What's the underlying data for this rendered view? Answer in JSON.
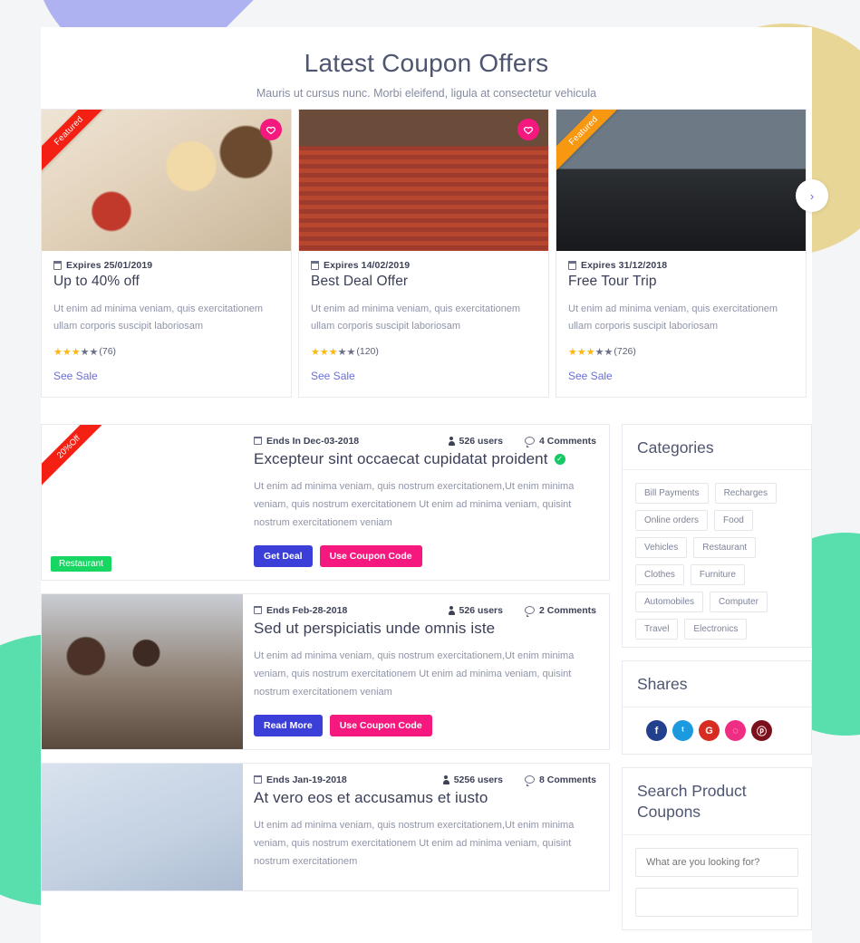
{
  "section": {
    "title": "Latest Coupon Offers",
    "subtitle": "Mauris ut cursus nunc. Morbi eleifend, ligula at consectetur vehicula"
  },
  "offers": [
    {
      "ribbon": "Featured",
      "ribbon_color": "#f32013",
      "expires": "Expires 25/01/2019",
      "title": "Up to 40% off",
      "desc": "Ut enim ad minima veniam, quis exercitationem ullam corporis suscipit laboriosam",
      "rating": 3,
      "rating_count": "(76)",
      "link": "See Sale",
      "favorite": true,
      "image": "food-plate"
    },
    {
      "ribbon": "",
      "ribbon_color": "",
      "expires": "Expires 14/02/2019",
      "title": "Best Deal Offer",
      "desc": "Ut enim ad minima veniam, quis exercitationem ullam corporis suscipit laboriosam",
      "rating": 3,
      "rating_count": "(120)",
      "link": "See Sale",
      "favorite": true,
      "image": "hotel-staircase"
    },
    {
      "ribbon": "Featured",
      "ribbon_color": "#f79810",
      "expires": "Expires 31/12/2018",
      "title": "Free Tour Trip",
      "desc": "Ut enim ad minima veniam, quis exercitationem ullam corporis suscipit laboriosam",
      "rating": 3,
      "rating_count": "(726)",
      "link": "See Sale",
      "favorite": false,
      "image": "offroad-truck"
    }
  ],
  "carousel": {
    "next_label": "›"
  },
  "deals": [
    {
      "ribbon": "20%Off",
      "tag": "Restaurant",
      "ends": "Ends In Dec-03-2018",
      "users": "526 users",
      "comments": "4 Comments",
      "title": "Excepteur sint occaecat cupidatat proident",
      "verified": true,
      "desc": "Ut enim ad minima veniam, quis nostrum exercitationem,Ut enim minima veniam, quis nostrum exercitationem Ut enim ad minima veniam, quisint nostrum exercitationem veniam",
      "primary_action": "Get Deal",
      "secondary_action": "Use Coupon Code",
      "image": "pancakes"
    },
    {
      "ribbon": "",
      "tag": "",
      "ends": "Ends Feb-28-2018",
      "users": "526 users",
      "comments": "2 Comments",
      "title": "Sed ut perspiciatis unde omnis iste",
      "verified": false,
      "desc": "Ut enim ad minima veniam, quis nostrum exercitationem,Ut enim minima veniam, quis nostrum exercitationem Ut enim ad minima veniam, quisint nostrum exercitationem veniam",
      "primary_action": "Read More",
      "secondary_action": "Use Coupon Code",
      "image": "office-meeting"
    },
    {
      "ribbon": "",
      "tag": "",
      "ends": "Ends Jan-19-2018",
      "users": "5256 users",
      "comments": "8 Comments",
      "title": "At vero eos et accusamus et iusto",
      "verified": false,
      "desc": "Ut enim ad minima veniam, quis nostrum exercitationem,Ut enim minima veniam, quis nostrum exercitationem Ut enim ad minima veniam, quisint nostrum exercitationem",
      "primary_action": "",
      "secondary_action": "",
      "image": "blue-towel"
    }
  ],
  "sidebar": {
    "categories": {
      "title": "Categories",
      "items": [
        "Bill Payments",
        "Recharges",
        "Online orders",
        "Food",
        "Vehicles",
        "Restaurant",
        "Clothes",
        "Furniture",
        "Automobiles",
        "Computer",
        "Travel",
        "Electronics"
      ]
    },
    "shares": {
      "title": "Shares",
      "items": [
        {
          "name": "facebook",
          "glyph": "f",
          "color": "#23408e"
        },
        {
          "name": "twitter",
          "glyph": "ᵗ",
          "color": "#1b9ae0"
        },
        {
          "name": "google-plus",
          "glyph": "G",
          "color": "#d62d20"
        },
        {
          "name": "dribbble",
          "glyph": "◌",
          "color": "#ef2d83"
        },
        {
          "name": "pinterest",
          "glyph": "ⓟ",
          "color": "#7b0f1b"
        }
      ]
    },
    "search": {
      "title": "Search Product Coupons",
      "placeholder": "What are you looking for?",
      "value": "",
      "placeholder2": ""
    }
  },
  "colors": {
    "accent_blue": "#3b3fd8",
    "accent_pink": "#f5197f",
    "link": "#6b6fd4",
    "star_on": "#fcb714",
    "green_tag": "#17d661",
    "ribbon_red": "#f32013",
    "ribbon_orange": "#f79810",
    "deco_periwinkle": "#aeb2f0",
    "deco_yellow": "#e8d697",
    "deco_teal": "#59dfad"
  }
}
